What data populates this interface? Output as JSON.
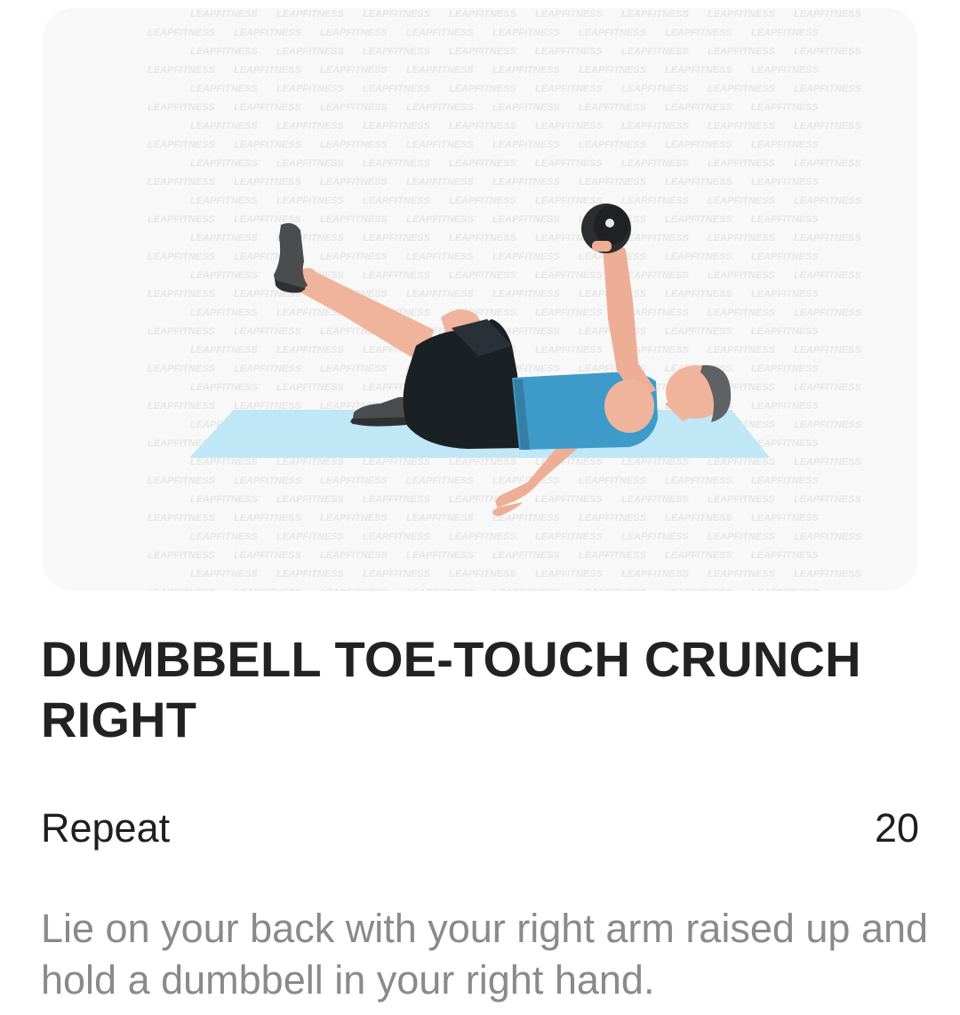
{
  "exercise": {
    "title": "DUMBBELL TOE-TOUCH CRUNCH RIGHT",
    "repeat_label": "Repeat",
    "repeat_count": "20",
    "description": "Lie on your back with your right arm raised up and hold a dumbbell in your right hand.",
    "illustration": {
      "watermark_text": "LEAPFITNESS",
      "icon": "exercise-illustration"
    }
  },
  "colors": {
    "card_bg": "#f8f8f8",
    "mat": "#bfe7f5",
    "tank_top": "#3e9bc9",
    "shorts": "#1b2025",
    "skin": "#f0b49c",
    "hair": "#5f6163",
    "shoe": "#4a4c4e",
    "dumbbell": "#2b2d30",
    "title_text": "#222222",
    "body_text": "#1f1f1f",
    "description_text": "#8a8a8a"
  }
}
